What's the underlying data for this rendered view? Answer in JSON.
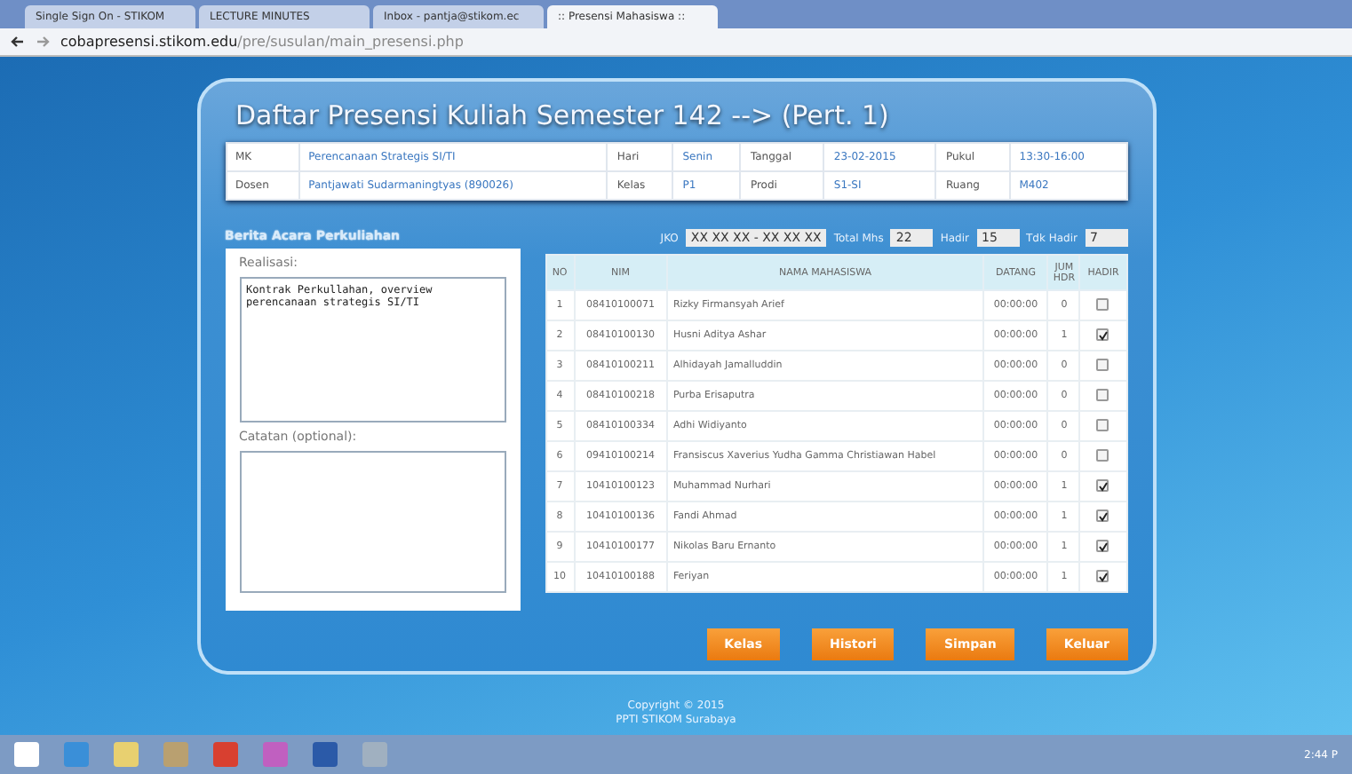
{
  "browser": {
    "tabs": [
      {
        "label": "Single Sign On - STIKOM",
        "selected": false
      },
      {
        "label": "LECTURE MINUTES",
        "selected": false
      },
      {
        "label": "Inbox - pantja@stikom.ec",
        "selected": false
      },
      {
        "label": ":: Presensi Mahasiswa ::",
        "selected": true
      }
    ],
    "url_host": "cobapresensi.stikom.edu",
    "url_path": "/pre/susulan/main_presensi.php"
  },
  "title": "Daftar Presensi Kuliah Semester 142 --> (Pert. 1)",
  "info": [
    [
      {
        "label": "MK",
        "value": "Perencanaan Strategis SI/TI"
      },
      {
        "label": "Hari",
        "value": "Senin"
      },
      {
        "label": "Tanggal",
        "value": "23-02-2015"
      },
      {
        "label": "Pukul",
        "value": "13:30-16:00"
      }
    ],
    [
      {
        "label": "Dosen",
        "value": "Pantjawati Sudarmaningtyas (890026)"
      },
      {
        "label": "Kelas",
        "value": "P1"
      },
      {
        "label": "Prodi",
        "value": "S1-SI"
      },
      {
        "label": "Ruang",
        "value": "M402"
      }
    ]
  ],
  "berita_acara": {
    "heading": "Berita Acara Perkuliahan",
    "realisasi_label": "Realisasi:",
    "realisasi_value": "Kontrak Perkullahan, overview perencanaan strategis SI/TI",
    "catatan_label": "Catatan (optional):"
  },
  "summary": [
    {
      "label": "JKO",
      "value": "XX XX XX - XX XX XX"
    },
    {
      "label": "Total Mhs",
      "value": "22"
    },
    {
      "label": "Hadir",
      "value": "15"
    },
    {
      "label": "Tdk Hadir",
      "value": "7"
    }
  ],
  "table": {
    "columns": [
      "NO",
      "NIM",
      "NAMA MAHASISWA",
      "DATANG",
      "JUM HDR",
      "HADIR"
    ],
    "rows": [
      {
        "no": "1",
        "nim": "08410100071",
        "nama": "Rizky Firmansyah Arief",
        "datang": "00:00:00",
        "jum": "0",
        "checked": false
      },
      {
        "no": "2",
        "nim": "08410100130",
        "nama": "Husni Aditya Ashar",
        "datang": "00:00:00",
        "jum": "1",
        "checked": true
      },
      {
        "no": "3",
        "nim": "08410100211",
        "nama": "Alhidayah Jamalluddin",
        "datang": "00:00:00",
        "jum": "0",
        "checked": false
      },
      {
        "no": "4",
        "nim": "08410100218",
        "nama": "Purba Erisaputra",
        "datang": "00:00:00",
        "jum": "0",
        "checked": false
      },
      {
        "no": "5",
        "nim": "08410100334",
        "nama": "Adhi Widiyanto",
        "datang": "00:00:00",
        "jum": "0",
        "checked": false
      },
      {
        "no": "6",
        "nim": "09410100214",
        "nama": "Fransiscus Xaverius Yudha Gamma Christiawan Habel",
        "datang": "00:00:00",
        "jum": "0",
        "checked": false
      },
      {
        "no": "7",
        "nim": "10410100123",
        "nama": "Muhammad Nurhari",
        "datang": "00:00:00",
        "jum": "1",
        "checked": true
      },
      {
        "no": "8",
        "nim": "10410100136",
        "nama": "Fandi Ahmad",
        "datang": "00:00:00",
        "jum": "1",
        "checked": true
      },
      {
        "no": "9",
        "nim": "10410100177",
        "nama": "Nikolas Baru Ernanto",
        "datang": "00:00:00",
        "jum": "1",
        "checked": true
      },
      {
        "no": "10",
        "nim": "10410100188",
        "nama": "Feriyan",
        "datang": "00:00:00",
        "jum": "1",
        "checked": true
      }
    ]
  },
  "buttons": [
    "Kelas",
    "Histori",
    "Simpan",
    "Keluar"
  ],
  "footer": [
    "Copyright © 2015",
    "PPTI STIKOM Surabaya"
  ],
  "taskbar": {
    "clock": "2:44 P"
  }
}
